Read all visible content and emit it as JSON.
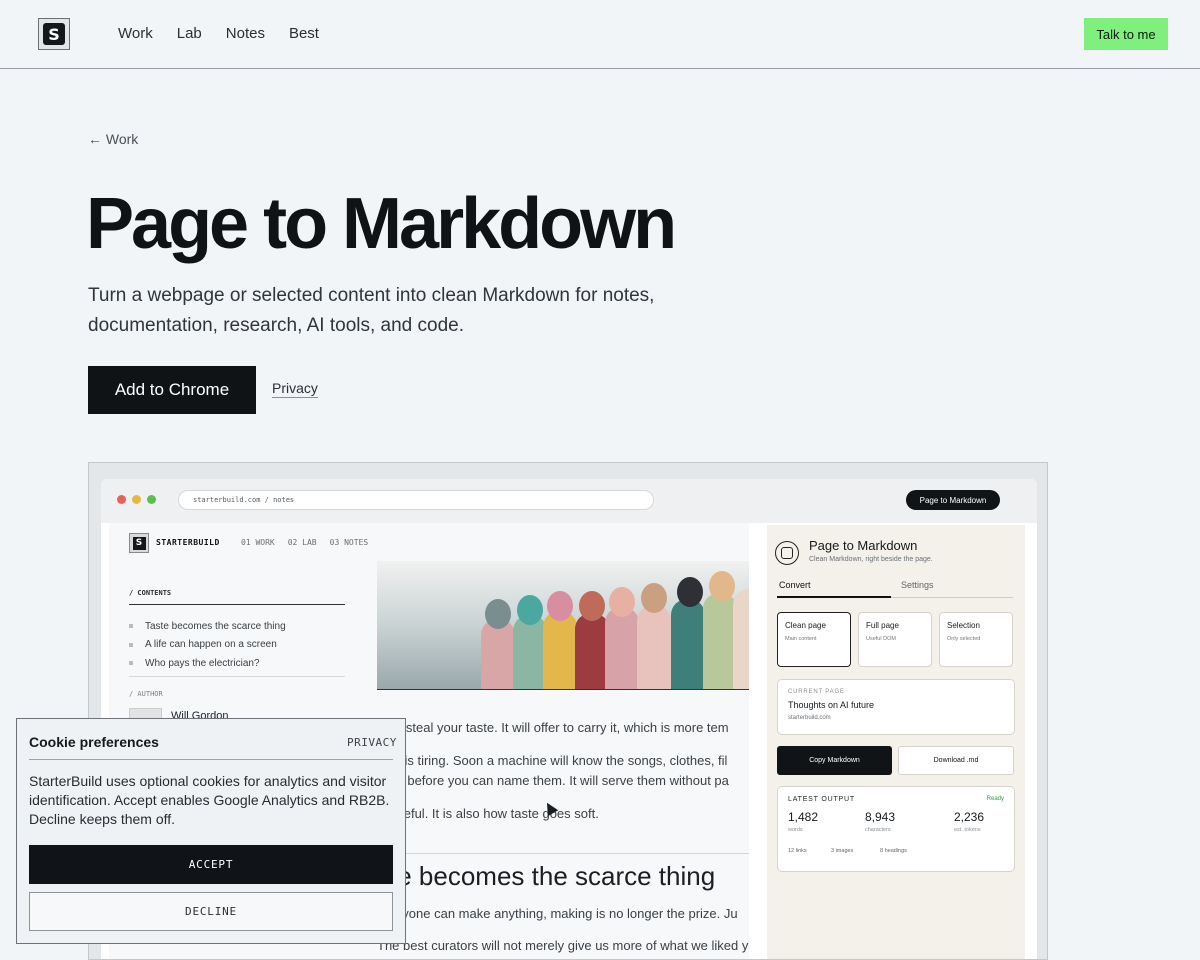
{
  "nav": {
    "logo_glyph": "S",
    "items": [
      "Work",
      "Lab",
      "Notes",
      "Best"
    ],
    "cta": "Talk to me"
  },
  "hero": {
    "back": "← Work",
    "title": "Page to Markdown",
    "lead": "Turn a webpage or selected content into clean Markdown for notes, documentation, research, AI tools, and code.",
    "primary_cta": "Add to Chrome",
    "secondary_link": "Privacy"
  },
  "preview": {
    "browser": {
      "url": "starterbuild.com / notes",
      "toolbar_pill": "Page to Markdown"
    },
    "site": {
      "brand": "STARTERBUILD",
      "nav": [
        "01 WORK",
        "02 LAB",
        "03 NOTES"
      ],
      "contents_label": "/ CONTENTS",
      "toc": [
        "Taste becomes the scarce thing",
        "A life can happen on a screen",
        "Who pays the electrician?"
      ],
      "author_label": "/ AUTHOR",
      "author_name": "Will Gordon",
      "paragraphs": [
        "I not steal your taste. It will offer to carry it, which is more tem",
        "sing is tiring. Soon a machine will know the songs, clothes, fil",
        "refer before you can name them. It will serve them without pa",
        "is useful. It is also how taste goes soft."
      ],
      "heading": "ste becomes the scarce thing",
      "paragraphs2": [
        "n anyone can make anything, making is no longer the prize. Ju",
        "The best curators will not merely give us more of what we liked ye"
      ]
    },
    "extension": {
      "title": "Page to Markdown",
      "subtitle": "Clean Markdown, right beside the page.",
      "tabs": [
        "Convert",
        "Settings"
      ],
      "modes": [
        {
          "title": "Clean page",
          "sub": "Main content"
        },
        {
          "title": "Full page",
          "sub": "Useful DOM"
        },
        {
          "title": "Selection",
          "sub": "Only selected"
        }
      ],
      "current_page_label": "CURRENT PAGE",
      "current_page_title": "Thoughts on AI future",
      "current_page_domain": "starterbuild.com",
      "copy_btn": "Copy Markdown",
      "download_btn": "Download .md",
      "output_label": "LATEST OUTPUT",
      "output_status": "Ready",
      "stats": [
        {
          "value": "1,482",
          "label": "words"
        },
        {
          "value": "8,943",
          "label": "characters"
        },
        {
          "value": "2,236",
          "label": "est. tokens"
        }
      ],
      "meta": [
        "12 links",
        "3 images",
        "8 headings"
      ]
    }
  },
  "cookie": {
    "title": "Cookie preferences",
    "privacy": "PRIVACY",
    "text": "StarterBuild uses optional cookies for analytics and visitor identification. Accept enables Google Analytics and RB2B. Decline keeps them off.",
    "accept": "ACCEPT",
    "decline": "DECLINE"
  },
  "colors": {
    "accent_green": "#7ff07e",
    "dark": "#0f1316",
    "ready_green": "#2a9a4a"
  }
}
